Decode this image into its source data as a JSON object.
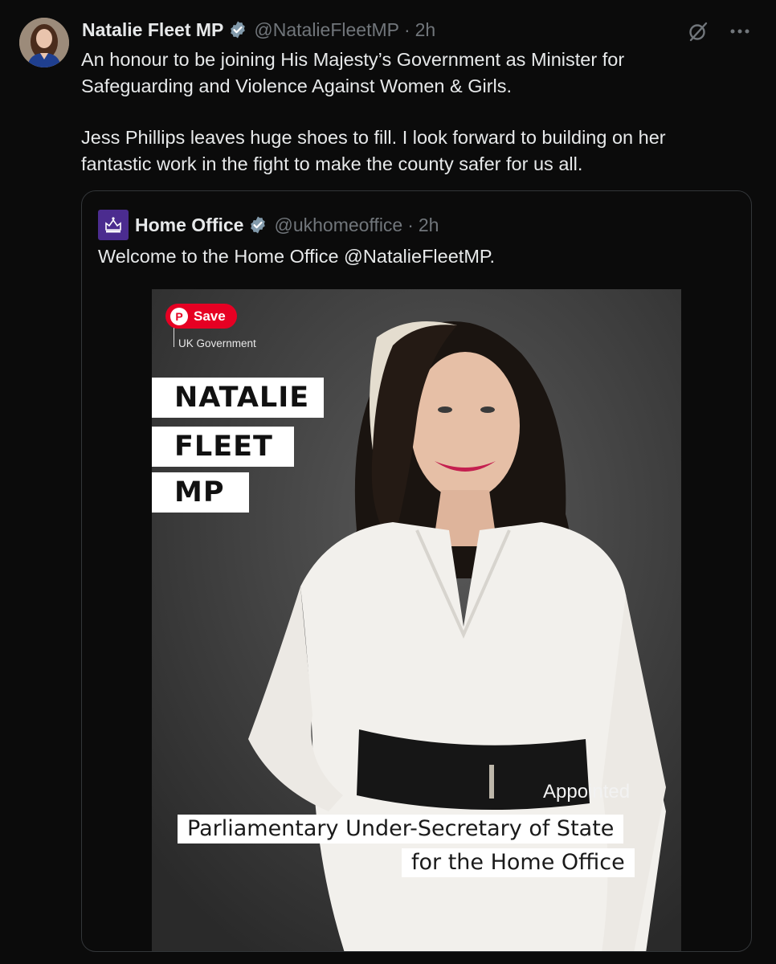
{
  "author": {
    "display_name": "Natalie Fleet MP",
    "handle": "@NatalieFleetMP",
    "separator": "·",
    "time": "2h"
  },
  "tweet": {
    "paragraph_1": "An honour to be joining His Majesty’s Government as Minister for Safeguarding and Violence Against Women & Girls.",
    "paragraph_2": "Jess Phillips leaves huge shoes to fill. I look forward to building on her fantastic work in the fight to make the county safer for us all."
  },
  "quoted": {
    "display_name": "Home Office",
    "handle": "@ukhomeoffice",
    "separator": "·",
    "time": "2h",
    "text": "Welcome to the Home Office @NatalieFleetMP.",
    "image": {
      "save_label": "Save",
      "gov_label": "UK Government",
      "name_line_1": "NATALIE",
      "name_line_2": "FLEET",
      "name_line_3": "MP",
      "appointed_label": "Appointed",
      "role_line_1": "Parliamentary Under-Secretary of State",
      "role_line_2": "for the Home Office"
    }
  },
  "icons": {
    "verified": "verified-badge-icon",
    "grok": "grok-icon",
    "more": "more-icon",
    "home_office_logo": "crown-logo-icon",
    "pinterest": "pinterest-icon"
  },
  "colors": {
    "background": "#0b0b0b",
    "text_primary": "#e7e9ea",
    "text_secondary": "#71767b",
    "verified": "#829aab",
    "home_office_purple": "#4b2c8f",
    "pinterest_red": "#e60023"
  }
}
